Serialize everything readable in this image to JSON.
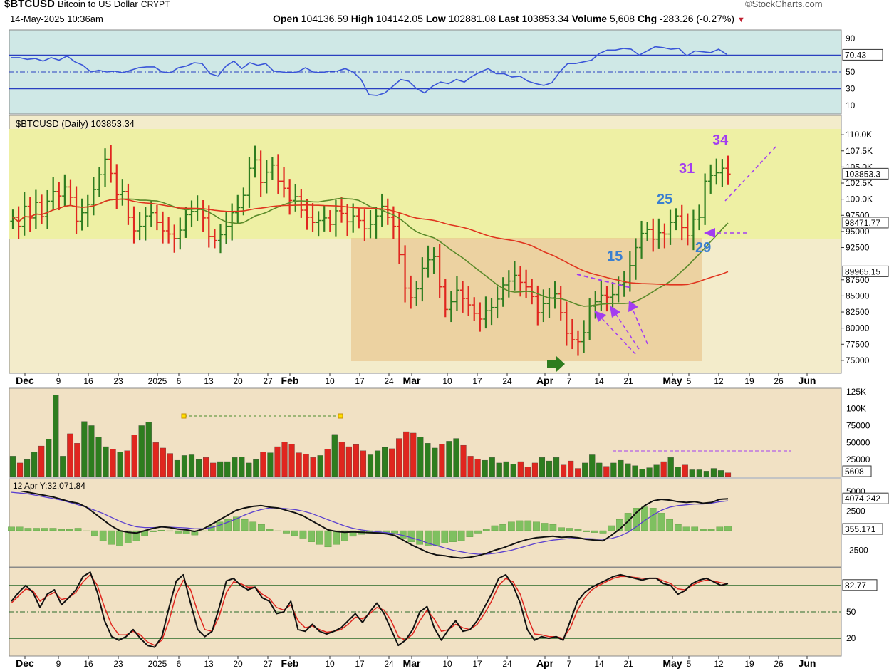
{
  "header": {
    "symbol": "$BTCUSD",
    "name": "Bitcoin to US Dollar",
    "exchange": "CRYPT",
    "datetime": "14-May-2025 10:36am",
    "brand": "©StockCharts.com",
    "quote": {
      "open_label": "Open",
      "open": "104136.59",
      "high_label": "High",
      "high": "104142.05",
      "low_label": "Low",
      "low": "102881.08",
      "last_label": "Last",
      "last": "103853.34",
      "volume_label": "Volume",
      "volume": "5,608",
      "chg_label": "Chg",
      "chg": "-283.26 (-0.27%)"
    }
  },
  "colors": {
    "up": "#2e7d1f",
    "down": "#e0261f",
    "sma_fast": "#5a8a2a",
    "sma_slow": "#e0341e",
    "rsi": "#3a55d8",
    "macd": "#111111",
    "signal": "#5a3fd0",
    "hist": "#7fc060",
    "annot_purple": "#a33df0",
    "annot_blue": "#3a7fd0",
    "arrow_green": "#2e7d1f"
  },
  "chart_data": [
    {
      "type": "line",
      "panel": "rsi",
      "ylim": [
        0,
        100
      ],
      "yticks": [
        10,
        30,
        50,
        70,
        90
      ],
      "last_value": "70.43",
      "values": [
        67,
        67,
        65,
        66,
        63,
        67,
        64,
        69,
        62,
        58,
        50,
        52,
        50,
        51,
        49,
        52,
        55,
        56,
        56,
        50,
        49,
        55,
        57,
        61,
        60,
        48,
        45,
        57,
        63,
        54,
        61,
        58,
        60,
        51,
        50,
        49,
        50,
        55,
        50,
        49,
        51,
        51,
        54,
        50,
        41,
        23,
        22,
        25,
        33,
        41,
        39,
        30,
        25,
        33,
        38,
        36,
        41,
        38,
        45,
        50,
        54,
        48,
        48,
        44,
        45,
        39,
        36,
        34,
        37,
        50,
        60,
        60,
        62,
        64,
        72,
        76,
        76,
        78,
        77,
        70,
        75,
        80,
        79,
        77,
        78,
        69,
        75,
        74,
        73,
        77,
        71
      ]
    },
    {
      "type": "candlestick",
      "panel": "price",
      "title": "$BTCUSD (Daily) 103853.34",
      "ylim": [
        73000,
        113000
      ],
      "yticks": [
        "110.0K",
        "107.5K",
        "105.0K",
        "102.5K",
        "100.0K",
        "97500",
        "95000",
        "92500",
        "87500",
        "85000",
        "82500",
        "80000",
        "77500",
        "75000"
      ],
      "price_labels": [
        "103853.3",
        "98471.77",
        "89965.15"
      ],
      "x_labels": [
        "Dec",
        "9",
        "16",
        "23",
        "2025",
        "6",
        "13",
        "20",
        "27",
        "Feb",
        "10",
        "17",
        "24",
        "Mar",
        "10",
        "17",
        "24",
        "Apr",
        "7",
        "14",
        "21",
        "May",
        "5",
        "12",
        "19",
        "26",
        "Jun"
      ],
      "close": [
        97200,
        95800,
        98900,
        97100,
        99500,
        97300,
        99700,
        101200,
        100500,
        101900,
        100300,
        96600,
        97900,
        99200,
        101500,
        103800,
        106200,
        104000,
        100700,
        101200,
        97200,
        95100,
        95800,
        97400,
        97900,
        96400,
        95100,
        94600,
        93900,
        95200,
        97600,
        98100,
        98400,
        97100,
        94200,
        93600,
        94500,
        95800,
        97900,
        98700,
        100600,
        104800,
        106100,
        102600,
        104200,
        105300,
        102800,
        101700,
        99800,
        100400,
        98300,
        97200,
        96400,
        96700,
        97100,
        96100,
        98200,
        97800,
        96500,
        97400,
        96700,
        95400,
        96100,
        97400,
        98900,
        97200,
        95800,
        91400,
        86200,
        84700,
        86100,
        89300,
        90600,
        91100,
        86400,
        82900,
        84100,
        85900,
        84600,
        83600,
        82300,
        81400,
        82700,
        83200,
        84500,
        86700,
        87300,
        88200,
        87100,
        86400,
        84900,
        82400,
        83800,
        84700,
        85300,
        82400,
        79200,
        78200,
        77900,
        79300,
        83400,
        84100,
        85100,
        84800,
        85200,
        86800,
        87100,
        89700,
        92500,
        94700,
        95300,
        93800,
        94800,
        94600,
        96400,
        97400,
        95600,
        94300,
        96900,
        97200,
        102800,
        103700,
        104100,
        104800,
        103900
      ]
    },
    {
      "type": "bar",
      "panel": "volume",
      "ylim": [
        0,
        130000
      ],
      "yticks": [
        "125K",
        "100K",
        "75000",
        "50000",
        "25000"
      ],
      "last_value": "5608",
      "values": [
        30000,
        20000,
        25000,
        36000,
        45000,
        55000,
        120000,
        30000,
        63000,
        49000,
        81000,
        75000,
        58000,
        44000,
        40000,
        36000,
        38000,
        61000,
        75000,
        80000,
        50000,
        42000,
        34000,
        24000,
        31000,
        32000,
        25000,
        28000,
        20000,
        22000,
        22000,
        28000,
        29000,
        20000,
        25000,
        36000,
        35000,
        44000,
        51000,
        48000,
        35000,
        33000,
        28000,
        31000,
        40000,
        62000,
        51000,
        44000,
        47000,
        38000,
        32000,
        38000,
        43000,
        41000,
        56000,
        66000,
        64000,
        58000,
        49000,
        42000,
        48000,
        52000,
        56000,
        46000,
        30000,
        26000,
        24000,
        28000,
        20000,
        22000,
        18000,
        22000,
        14000,
        20000,
        28000,
        23000,
        28000,
        17000,
        23000,
        12000,
        20000,
        32000,
        20000,
        15000,
        20000,
        24000,
        19000,
        16000,
        11000,
        13000,
        17000,
        22000,
        28000,
        14000,
        17000,
        10000,
        10000,
        8000,
        12000,
        9000,
        5608
      ]
    },
    {
      "type": "line",
      "panel": "macd",
      "annotation": "12 Apr Y:32,071.84",
      "yticks": [
        "5000",
        "2500",
        "-2500"
      ],
      "value_labels": [
        "4074.242",
        "355.171"
      ],
      "macd": [
        5200,
        5100,
        4900,
        4700,
        4500,
        4300,
        4000,
        3700,
        3500,
        3000,
        2200,
        1400,
        600,
        0,
        -200,
        -300,
        0,
        300,
        500,
        400,
        200,
        100,
        -100,
        200,
        800,
        1400,
        2000,
        2600,
        2900,
        3100,
        3200,
        3000,
        2900,
        2600,
        2300,
        1900,
        1300,
        700,
        100,
        -100,
        -200,
        -150,
        -200,
        -250,
        -300,
        -400,
        -600,
        -1200,
        -1800,
        -2300,
        -2800,
        -3100,
        -3200,
        -3400,
        -3500,
        -3400,
        -3200,
        -2900,
        -2500,
        -2200,
        -1800,
        -1400,
        -1100,
        -900,
        -800,
        -700,
        -850,
        -800,
        -900,
        -1100,
        -1200,
        -1300,
        -600,
        200,
        1200,
        2300,
        3200,
        3800,
        4000,
        3900,
        3700,
        3600,
        3700,
        3500,
        3600,
        4000,
        4074
      ],
      "signal": [
        4900,
        4800,
        4700,
        4500,
        4300,
        4100,
        3900,
        3600,
        3300,
        3000,
        2600,
        2200,
        1700,
        1200,
        800,
        500,
        400,
        400,
        450,
        450,
        400,
        350,
        250,
        250,
        400,
        700,
        1100,
        1500,
        2000,
        2400,
        2700,
        2900,
        2900,
        2800,
        2700,
        2500,
        2200,
        1800,
        1400,
        1000,
        600,
        300,
        100,
        -50,
        -150,
        -250,
        -400,
        -600,
        -900,
        -1200,
        -1600,
        -1900,
        -2200,
        -2500,
        -2700,
        -2900,
        -3000,
        -3000,
        -2900,
        -2700,
        -2500,
        -2200,
        -1900,
        -1600,
        -1400,
        -1200,
        -1100,
        -1000,
        -1000,
        -1000,
        -1050,
        -1100,
        -1000,
        -700,
        -200,
        500,
        1300,
        2000,
        2600,
        3000,
        3200,
        3300,
        3400,
        3400,
        3500,
        3700,
        3800
      ],
      "hist": [
        300,
        300,
        200,
        200,
        200,
        200,
        100,
        100,
        200,
        0,
        -400,
        -800,
        -1100,
        -1200,
        -1000,
        -800,
        -400,
        -100,
        50,
        -50,
        -200,
        -250,
        -350,
        -50,
        400,
        700,
        900,
        1100,
        900,
        700,
        500,
        100,
        0,
        -200,
        -400,
        -600,
        -900,
        -1100,
        -1300,
        -1100,
        -800,
        -450,
        -300,
        -200,
        -150,
        -150,
        -200,
        -600,
        -900,
        -1100,
        -1200,
        -1200,
        -1000,
        -900,
        -800,
        -500,
        -200,
        100,
        400,
        500,
        700,
        800,
        800,
        700,
        600,
        500,
        250,
        200,
        100,
        -100,
        -150,
        -200,
        400,
        900,
        1400,
        1800,
        1900,
        1800,
        1400,
        900,
        500,
        300,
        300,
        100,
        100,
        300,
        355
      ]
    },
    {
      "type": "line",
      "panel": "stochastic",
      "ylim": [
        0,
        100
      ],
      "yticks": [
        "50",
        "20"
      ],
      "last_value": "82.77",
      "k": [
        62,
        72,
        80,
        72,
        55,
        70,
        75,
        58,
        66,
        75,
        90,
        95,
        72,
        40,
        22,
        18,
        22,
        30,
        20,
        12,
        10,
        22,
        55,
        85,
        92,
        60,
        30,
        22,
        28,
        55,
        85,
        88,
        80,
        75,
        78,
        66,
        62,
        48,
        50,
        62,
        30,
        28,
        36,
        28,
        25,
        28,
        32,
        40,
        48,
        38,
        50,
        60,
        48,
        30,
        12,
        18,
        30,
        50,
        56,
        32,
        18,
        30,
        40,
        28,
        30,
        40,
        55,
        70,
        88,
        92,
        80,
        60,
        30,
        18,
        22,
        20,
        22,
        18,
        40,
        62,
        72,
        78,
        82,
        86,
        90,
        92,
        90,
        88,
        86,
        88,
        88,
        82,
        80,
        70,
        74,
        82,
        86,
        88,
        84,
        80,
        82
      ],
      "d": [
        60,
        68,
        76,
        74,
        62,
        68,
        72,
        64,
        66,
        72,
        84,
        92,
        80,
        55,
        35,
        24,
        24,
        28,
        24,
        16,
        12,
        18,
        40,
        70,
        86,
        75,
        50,
        30,
        28,
        45,
        72,
        84,
        82,
        78,
        78,
        70,
        65,
        55,
        52,
        58,
        40,
        32,
        34,
        30,
        27,
        28,
        30,
        36,
        44,
        42,
        48,
        55,
        52,
        40,
        22,
        18,
        25,
        40,
        52,
        42,
        28,
        30,
        36,
        32,
        30,
        36,
        48,
        62,
        80,
        88,
        84,
        70,
        45,
        25,
        24,
        22,
        22,
        20,
        32,
        52,
        66,
        75,
        80,
        84,
        88,
        90,
        90,
        89,
        88,
        88,
        88,
        85,
        82,
        76,
        75,
        80,
        84,
        86,
        85,
        83,
        82
      ]
    }
  ]
}
